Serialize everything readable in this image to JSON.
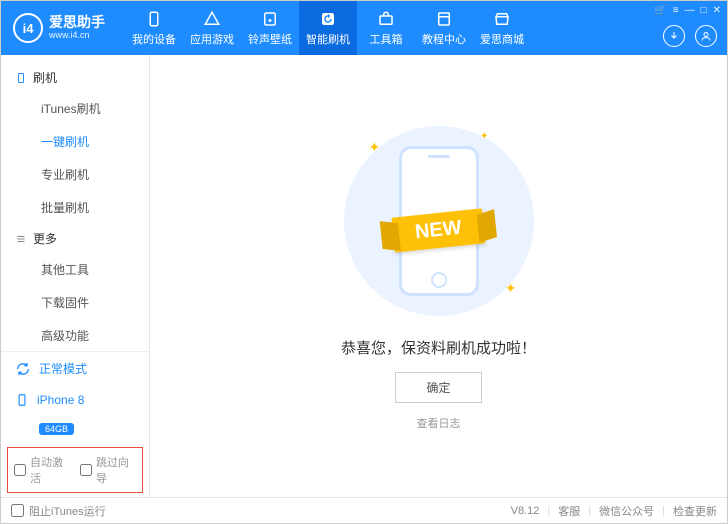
{
  "app": {
    "name": "爱思助手",
    "url": "www.i4.cn",
    "logo_text": "i4"
  },
  "window_controls": {
    "cart": "🛒",
    "menu": "≡",
    "min": "—",
    "max": "□",
    "close": "✕"
  },
  "tabs": [
    {
      "label": "我的设备",
      "icon": "device"
    },
    {
      "label": "应用游戏",
      "icon": "apps"
    },
    {
      "label": "铃声壁纸",
      "icon": "music"
    },
    {
      "label": "智能刷机",
      "icon": "refresh",
      "active": true
    },
    {
      "label": "工具箱",
      "icon": "toolbox"
    },
    {
      "label": "教程中心",
      "icon": "book"
    },
    {
      "label": "爱思商城",
      "icon": "shop"
    }
  ],
  "sidebar": {
    "sections": [
      {
        "title": "刷机",
        "items": [
          "iTunes刷机",
          "一键刷机",
          "专业刷机",
          "批量刷机"
        ],
        "active_index": 1
      },
      {
        "title": "更多",
        "items": [
          "其他工具",
          "下载固件",
          "高级功能"
        ]
      }
    ],
    "mode": "正常模式",
    "device": {
      "name": "iPhone 8",
      "storage": "64GB"
    },
    "checkboxes": {
      "auto_activate": "自动激活",
      "skip_guide": "跳过向导"
    }
  },
  "main": {
    "ribbon": "NEW",
    "message": "恭喜您，保资料刷机成功啦！",
    "ok": "确定",
    "view_log": "查看日志"
  },
  "footer": {
    "block_itunes": "阻止iTunes运行",
    "version": "V8.12",
    "links": [
      "客服",
      "微信公众号",
      "检查更新"
    ]
  }
}
